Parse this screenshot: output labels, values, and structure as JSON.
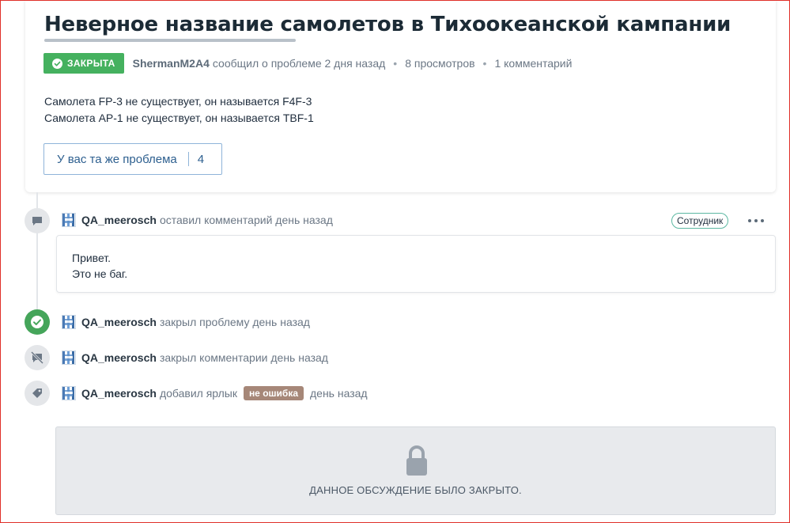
{
  "issue": {
    "title": "Неверное название самолетов в Тихоокеанской кампании",
    "status": "ЗАКРЫТА",
    "status_color": "#45b15f",
    "author": "ShermanM2A4",
    "reported_text": "сообщил о проблеме 2 дня назад",
    "views": "8 просмотров",
    "comments": "1 комментарий",
    "separator": "•",
    "body_lines": [
      "Самолета FP-3 не существует, он называется F4F-3",
      "Самолета AP-1 не существует, он называется TBF-1"
    ],
    "same_problem_label": "У вас та же проблема",
    "same_problem_count": "4"
  },
  "timeline": {
    "comment": {
      "user": "QA_meerosch",
      "action": "оставил комментарий день назад",
      "badge": "Сотрудник",
      "lines": [
        "Привет.",
        "Это не баг."
      ]
    },
    "closed_issue": {
      "user": "QA_meerosch",
      "action": "закрыл проблему день назад"
    },
    "closed_comments": {
      "user": "QA_meerosch",
      "action": "закрыл комментарии день назад"
    },
    "label_added": {
      "user": "QA_meerosch",
      "action": "добавил ярлык",
      "label": "не ошибка",
      "label_color": "#a68778",
      "when": "день назад"
    }
  },
  "locked": {
    "message": "ДАННОЕ ОБСУЖДЕНИЕ БЫЛО ЗАКРЫТО."
  }
}
